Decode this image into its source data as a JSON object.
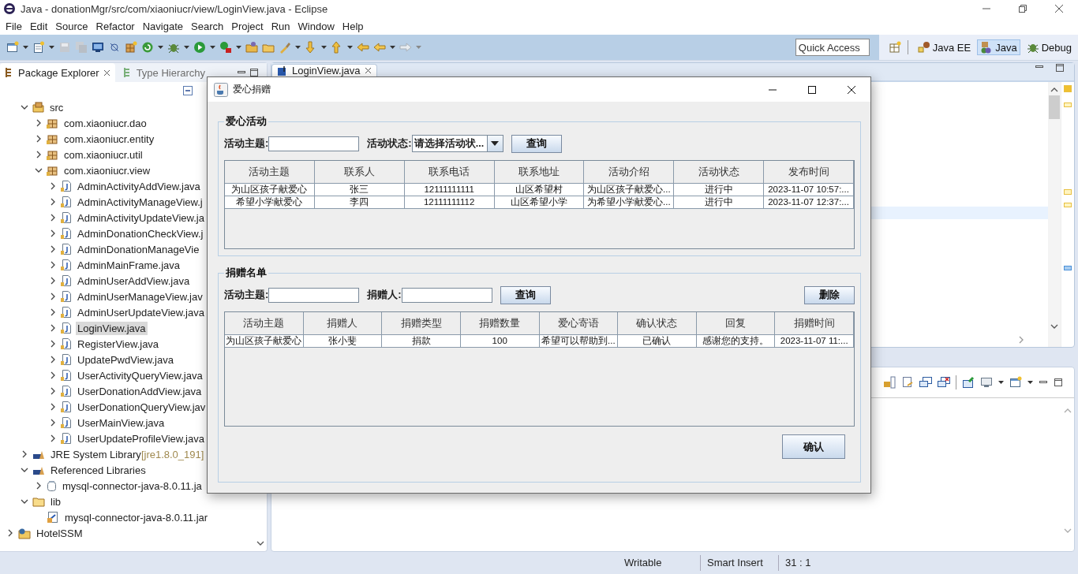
{
  "window": {
    "title": "Java - donationMgr/src/com/xiaoniucr/view/LoginView.java - Eclipse"
  },
  "menu": [
    "File",
    "Edit",
    "Source",
    "Refactor",
    "Navigate",
    "Search",
    "Project",
    "Run",
    "Window",
    "Help"
  ],
  "quick_access": {
    "placeholder": "Quick Access"
  },
  "perspectives": [
    {
      "label": "Java EE",
      "selected": false,
      "kind": "javaee"
    },
    {
      "label": "Java",
      "selected": true,
      "kind": "java"
    },
    {
      "label": "Debug",
      "selected": false,
      "kind": "debug"
    }
  ],
  "explorer": {
    "tabs": [
      {
        "label": "Package Explorer",
        "selected": true
      },
      {
        "label": "Type Hierarchy",
        "selected": false
      }
    ],
    "tree": [
      {
        "children": [
          {
            "label": "src",
            "kind": "source",
            "expanded": true,
            "selected": false,
            "children": [
              {
                "label": "com.xiaoniucr.dao",
                "kind": "package",
                "expanded": false,
                "selected": false
              },
              {
                "label": "com.xiaoniucr.entity",
                "kind": "package",
                "expanded": false,
                "selected": false
              },
              {
                "label": "com.xiaoniucr.util",
                "kind": "package",
                "expanded": false,
                "selected": false
              },
              {
                "label": "com.xiaoniucr.view",
                "kind": "package",
                "expanded": true,
                "selected": false,
                "children": [
                  {
                    "label": "AdminActivityAddView.java",
                    "kind": "java",
                    "expanded": false,
                    "selected": false
                  },
                  {
                    "label": "AdminActivityManageView.j",
                    "kind": "java",
                    "expanded": false,
                    "selected": false
                  },
                  {
                    "label": "AdminActivityUpdateView.ja",
                    "kind": "java",
                    "expanded": false,
                    "selected": false
                  },
                  {
                    "label": "AdminDonationCheckView.j",
                    "kind": "java",
                    "expanded": false,
                    "selected": false
                  },
                  {
                    "label": "AdminDonationManageVie",
                    "kind": "java",
                    "expanded": false,
                    "selected": false
                  },
                  {
                    "label": "AdminMainFrame.java",
                    "kind": "java",
                    "expanded": false,
                    "selected": false
                  },
                  {
                    "label": "AdminUserAddView.java",
                    "kind": "java",
                    "expanded": false,
                    "selected": false
                  },
                  {
                    "label": "AdminUserManageView.jav",
                    "kind": "java",
                    "expanded": false,
                    "selected": false
                  },
                  {
                    "label": "AdminUserUpdateView.java",
                    "kind": "java",
                    "expanded": false,
                    "selected": false
                  },
                  {
                    "label": "LoginView.java",
                    "kind": "java",
                    "expanded": false,
                    "selected": true
                  },
                  {
                    "label": "RegisterView.java",
                    "kind": "java",
                    "expanded": false,
                    "selected": false
                  },
                  {
                    "label": "UpdatePwdView.java",
                    "kind": "java",
                    "expanded": false,
                    "selected": false
                  },
                  {
                    "label": "UserActivityQueryView.java",
                    "kind": "java",
                    "expanded": false,
                    "selected": false
                  },
                  {
                    "label": "UserDonationAddView.java",
                    "kind": "java",
                    "expanded": false,
                    "selected": false
                  },
                  {
                    "label": "UserDonationQueryView.jav",
                    "kind": "java",
                    "expanded": false,
                    "selected": false
                  },
                  {
                    "label": "UserMainView.java",
                    "kind": "java",
                    "expanded": false,
                    "selected": false
                  },
                  {
                    "label": "UserUpdateProfileView.java",
                    "kind": "java",
                    "expanded": false,
                    "selected": false
                  }
                ]
              }
            ]
          },
          {
            "label": "JRE System Library",
            "decoration": "[jre1.8.0_191]",
            "kind": "library",
            "expanded": false,
            "selected": false
          },
          {
            "label": "Referenced Libraries",
            "kind": "library",
            "expanded": true,
            "selected": false,
            "children": [
              {
                "label": "mysql-connector-java-8.0.11.ja",
                "kind": "jar",
                "expanded": false,
                "selected": false
              }
            ]
          },
          {
            "label": "lib",
            "kind": "folder",
            "expanded": true,
            "selected": false,
            "children": [
              {
                "label": "mysql-connector-java-8.0.11.jar",
                "kind": "jarfile",
                "selected": false
              }
            ]
          }
        ]
      },
      {
        "label": "HotelSSM",
        "kind": "project",
        "expanded": false,
        "selected": false
      }
    ]
  },
  "editor": {
    "tabs": [
      {
        "label": "LoginView.java",
        "selected": true
      }
    ]
  },
  "dialog": {
    "title": "爱心捐赠",
    "groups": [
      {
        "title": "爱心活动",
        "filters": [
          {
            "kind": "text",
            "label": "活动主题:"
          },
          {
            "kind": "combo",
            "label": "活动状态:",
            "value": "请选择活动状..."
          }
        ],
        "query_button": "查询",
        "table": {
          "columns": [
            "活动主题",
            "联系人",
            "联系电话",
            "联系地址",
            "活动介绍",
            "活动状态",
            "发布时间"
          ],
          "rows": [
            [
              "为山区孩子献爱心",
              "张三",
              "12111111111",
              "山区希望村",
              "为山区孩子献爱心...",
              "进行中",
              "2023-11-07 10:57:..."
            ],
            [
              "希望小学献爱心",
              "李四",
              "12111111112",
              "山区希望小学",
              "为希望小学献爱心...",
              "进行中",
              "2023-11-07 12:37:..."
            ]
          ]
        }
      },
      {
        "title": "捐赠名单",
        "filters": [
          {
            "kind": "text",
            "label": "活动主题:"
          },
          {
            "kind": "text",
            "label": "捐赠人:"
          }
        ],
        "query_button": "查询",
        "action_button": "删除",
        "table": {
          "columns": [
            "活动主题",
            "捐赠人",
            "捐赠类型",
            "捐赠数量",
            "爱心寄语",
            "确认状态",
            "回复",
            "捐赠时间"
          ],
          "rows": [
            [
              "为山区孩子献爱心",
              "张小斐",
              "捐款",
              "100",
              "希望可以帮助到...",
              "已确认",
              "感谢您的支持。",
              "2023-11-07 11:..."
            ]
          ]
        },
        "confirm_button": "确认"
      }
    ]
  },
  "status_bar": [
    "Writable",
    "Smart Insert",
    "31 : 1"
  ]
}
